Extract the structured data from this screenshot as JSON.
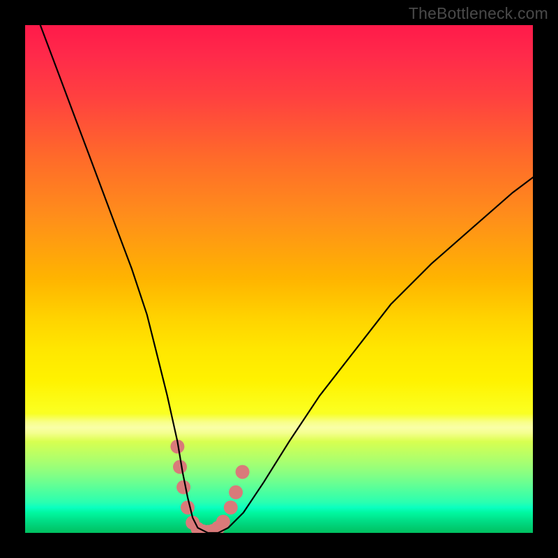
{
  "watermark": "TheBottleneck.com",
  "chart_data": {
    "type": "line",
    "title": "",
    "xlabel": "",
    "ylabel": "",
    "xlim": [
      0,
      100
    ],
    "ylim": [
      0,
      100
    ],
    "grid": false,
    "series": [
      {
        "name": "bottleneck-curve",
        "color": "#000000",
        "x": [
          3,
          6,
          9,
          12,
          15,
          18,
          21,
          24,
          26,
          28,
          30,
          31,
          32,
          33,
          34,
          36,
          38,
          40,
          43,
          47,
          52,
          58,
          65,
          72,
          80,
          88,
          96,
          100
        ],
        "y": [
          100,
          92,
          84,
          76,
          68,
          60,
          52,
          43,
          35,
          27,
          18,
          12,
          7,
          3,
          1,
          0,
          0,
          1,
          4,
          10,
          18,
          27,
          36,
          45,
          53,
          60,
          67,
          70
        ]
      }
    ],
    "markers": {
      "name": "highlighted-points",
      "color": "#d97a7a",
      "points": [
        {
          "x": 30.0,
          "y": 17
        },
        {
          "x": 30.5,
          "y": 13
        },
        {
          "x": 31.2,
          "y": 9
        },
        {
          "x": 32.0,
          "y": 5
        },
        {
          "x": 33.0,
          "y": 2
        },
        {
          "x": 34.0,
          "y": 0.8
        },
        {
          "x": 35.0,
          "y": 0.3
        },
        {
          "x": 36.0,
          "y": 0.2
        },
        {
          "x": 37.0,
          "y": 0.4
        },
        {
          "x": 38.0,
          "y": 1.0
        },
        {
          "x": 39.0,
          "y": 2.2
        },
        {
          "x": 40.5,
          "y": 5
        },
        {
          "x": 41.5,
          "y": 8
        },
        {
          "x": 42.8,
          "y": 12
        }
      ]
    },
    "annotations": []
  }
}
